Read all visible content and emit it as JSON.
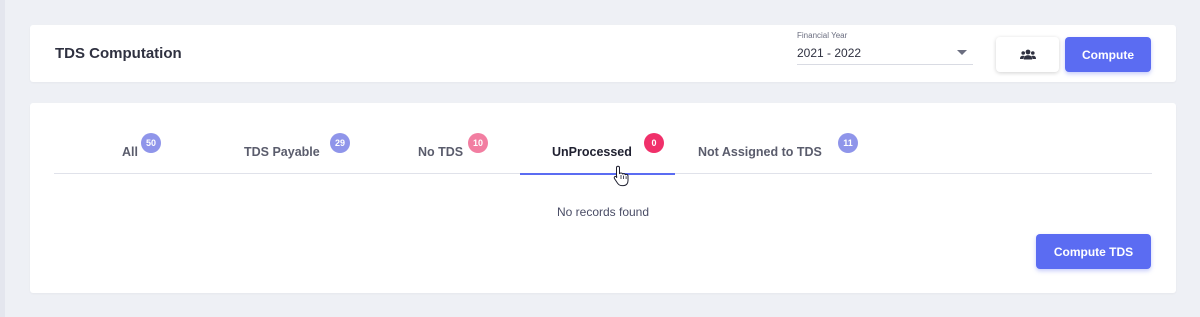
{
  "header": {
    "title": "TDS Computation",
    "financial_year": {
      "label": "Financial Year",
      "value": "2021 - 2022"
    },
    "users_icon": "users-icon",
    "compute_label": "Compute"
  },
  "tabs": [
    {
      "label": "All",
      "count": "50",
      "badge_color": "#8f95ea"
    },
    {
      "label": "TDS Payable",
      "count": "29",
      "badge_color": "#8f95ea"
    },
    {
      "label": "No TDS",
      "count": "10",
      "badge_color": "#f27ea1"
    },
    {
      "label": "UnProcessed",
      "count": "0",
      "badge_color": "#f0306a",
      "active": true
    },
    {
      "label": "Not Assigned to TDS",
      "count": "11",
      "badge_color": "#8f95ea"
    }
  ],
  "main": {
    "empty_message": "No records found",
    "compute_tds_label": "Compute TDS"
  },
  "colors": {
    "accent": "#5b6cf2",
    "background": "#eef0f5"
  }
}
